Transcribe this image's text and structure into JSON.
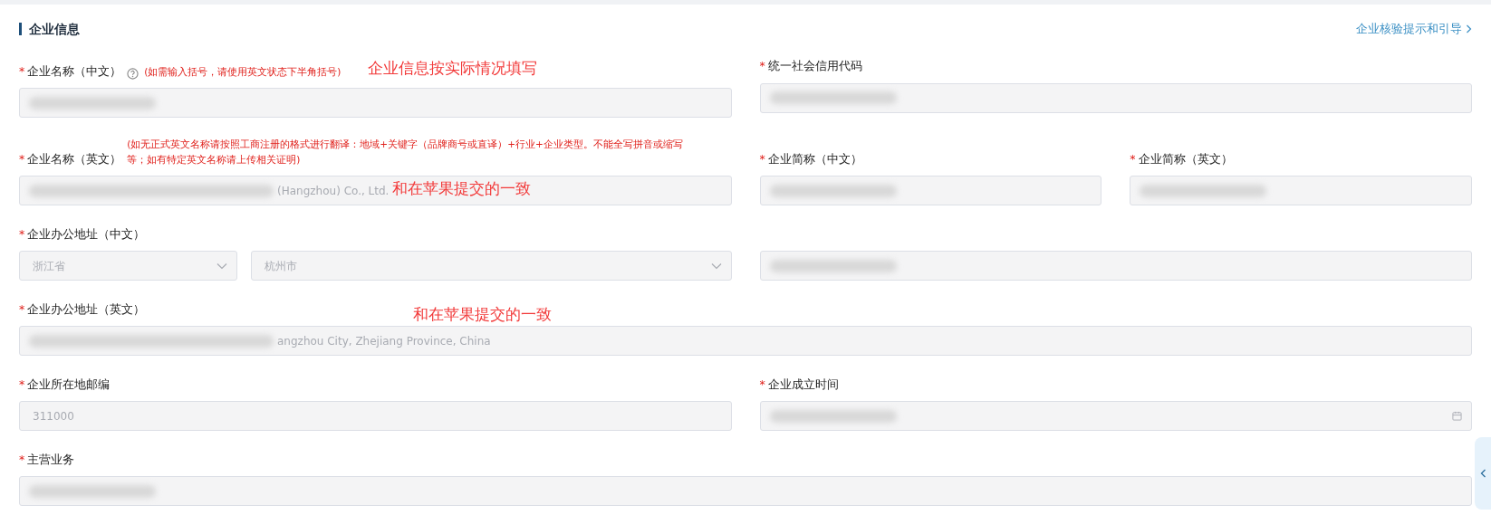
{
  "section": {
    "title": "企业信息",
    "link": "企业核验提示和引导"
  },
  "rows": [
    {
      "cells": [
        {
          "kind": "field",
          "label": "企业名称（中文）",
          "required_mark": "*",
          "help_icon": true,
          "hint": "(如需输入括号，请使用英文状态下半角括号)",
          "annotation": {
            "kind": "label",
            "text": "企业信息按实际情况填写"
          },
          "inputs": [
            {
              "kind": "text",
              "redacted": true
            }
          ]
        },
        {
          "kind": "field",
          "label": "统一社会信用代码",
          "required_mark": "*",
          "inputs": [
            {
              "kind": "text",
              "redacted": true
            }
          ]
        }
      ]
    },
    {
      "cells": [
        {
          "kind": "field",
          "label": "企业名称（英文）",
          "required_mark": "*",
          "hint": "(如无正式英文名称请按照工商注册的格式进行翻译：地域+关键字（品牌商号或直译）+行业+企业类型。不能全写拼音或缩写等；如有特定英文名称请上传相关证明)",
          "annotation": {
            "kind": "input",
            "text": "和在苹果提交的一致"
          },
          "inputs": [
            {
              "kind": "text",
              "redacted": true,
              "value": "(Hangzhou) Co., Ltd."
            }
          ]
        },
        {
          "kind": "pair",
          "fields": [
            {
              "label": "企业简称（中文）",
              "required_mark": "*",
              "inputs": [
                {
                  "kind": "text",
                  "redacted": true
                }
              ]
            },
            {
              "label": "企业简称（英文）",
              "required_mark": "*",
              "inputs": [
                {
                  "kind": "text",
                  "redacted": true
                }
              ]
            }
          ]
        }
      ]
    },
    {
      "cells": [
        {
          "kind": "field",
          "label": "企业办公地址（中文）",
          "required_mark": "*",
          "inputs": [
            {
              "kind": "select",
              "value": "浙江省"
            },
            {
              "kind": "select",
              "value": "杭州市"
            }
          ]
        },
        {
          "kind": "field",
          "inputs": [
            {
              "kind": "text",
              "redacted": true
            }
          ]
        }
      ]
    },
    {
      "cells": [
        {
          "kind": "wide",
          "label": "企业办公地址（英文）",
          "required_mark": "*",
          "annotation": {
            "kind": "input",
            "text": "和在苹果提交的一致"
          },
          "inputs": [
            {
              "kind": "text",
              "redacted": true,
              "value": "angzhou City, Zhejiang Province, China"
            }
          ]
        }
      ]
    },
    {
      "cells": [
        {
          "kind": "field",
          "label": "企业所在地邮编",
          "required_mark": "*",
          "inputs": [
            {
              "kind": "text",
              "value": "311000"
            }
          ]
        },
        {
          "kind": "field",
          "label": "企业成立时间",
          "required_mark": "*",
          "inputs": [
            {
              "kind": "date",
              "redacted": true
            }
          ]
        }
      ]
    },
    {
      "cells": [
        {
          "kind": "wide",
          "label": "主营业务",
          "required_mark": "*",
          "inputs": [
            {
              "kind": "text",
              "redacted": true
            }
          ]
        }
      ]
    }
  ]
}
